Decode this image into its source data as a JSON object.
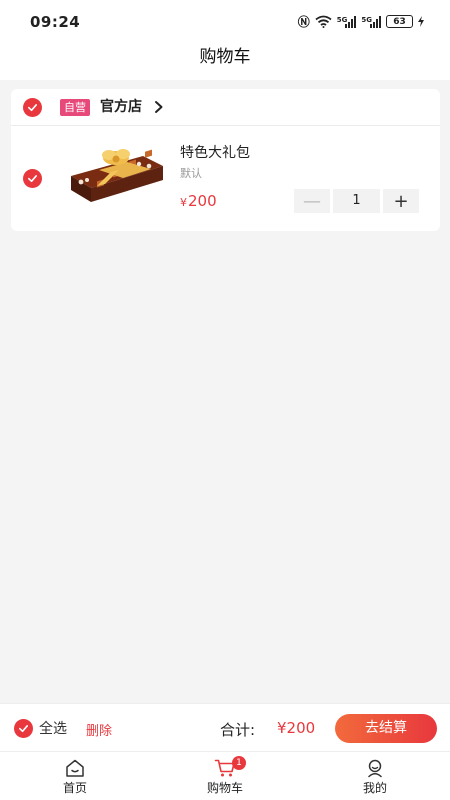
{
  "status_bar": {
    "time": "09:24",
    "network_1": "5G",
    "network_2": "5G",
    "battery": "63",
    "icons": [
      "nfc-icon",
      "wifi-icon",
      "signal-icon",
      "signal-icon",
      "battery-icon",
      "charging-icon"
    ]
  },
  "header": {
    "title": "购物车"
  },
  "shop": {
    "tag": "自营",
    "name": "官方店",
    "selected": true
  },
  "cart_items": [
    {
      "name": "特色大礼包",
      "spec": "默认",
      "price_symbol": "¥",
      "price": "200",
      "quantity": "1",
      "selected": true,
      "decrease_symbol": "—",
      "increase_symbol": "+"
    }
  ],
  "checkout": {
    "select_all_label": "全选",
    "delete_label": "删除",
    "total_label": "合计:",
    "total_value": "¥200",
    "checkout_label": "去结算",
    "all_selected": true
  },
  "tabs": [
    {
      "label": "首页",
      "icon": "home-icon",
      "active": false
    },
    {
      "label": "购物车",
      "icon": "cart-icon",
      "active": true,
      "badge": "1"
    },
    {
      "label": "我的",
      "icon": "profile-icon",
      "active": false
    }
  ],
  "colors": {
    "accent": "#e8383d",
    "tag": "#e74a7a",
    "background": "#f4f4f4"
  }
}
